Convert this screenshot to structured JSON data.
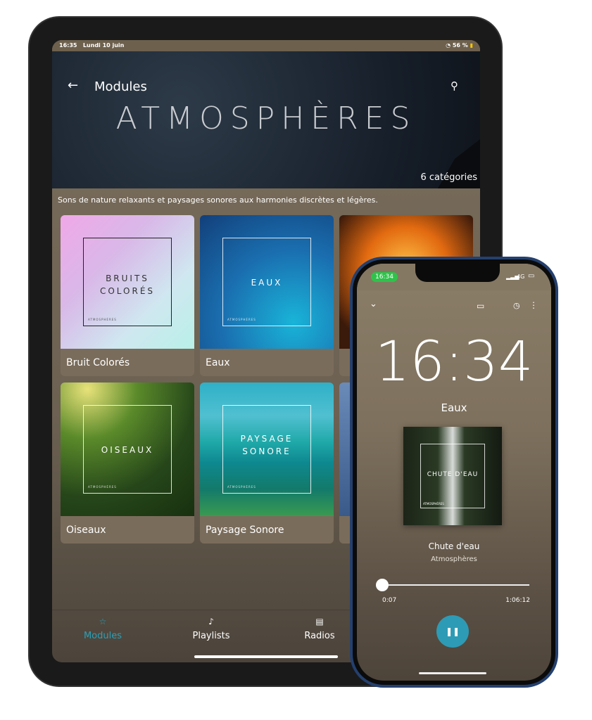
{
  "ipad": {
    "status": {
      "time": "16:35",
      "date": "Lundi 10 juin",
      "battery": "56 %"
    },
    "header": {
      "back_icon": "arrow-left-icon",
      "title": "Modules",
      "search_icon": "search-icon",
      "hero_title": "ATMOSPHÈRES",
      "count": "6 catégories"
    },
    "description": "Sons de nature relaxants et paysages sonores aux harmonies discrètes et légères.",
    "tiles": [
      {
        "label": "Bruit Colorés",
        "art_title": "BRUITS COLORÉS",
        "art_sub": "ATMOSPHÈRES"
      },
      {
        "label": "Eaux",
        "art_title": "EAUX",
        "art_sub": "ATMOSPHÈRES"
      },
      {
        "label": "",
        "art_title": "",
        "art_sub": ""
      },
      {
        "label": "Oiseaux",
        "art_title": "OISEAUX",
        "art_sub": "ATMOSPHÈRES"
      },
      {
        "label": "Paysage Sonore",
        "art_title": "PAYSAGE SONORE",
        "art_sub": "ATMOSPHÈRES"
      },
      {
        "label": "",
        "art_title": "",
        "art_sub": ""
      }
    ],
    "nav": [
      {
        "label": "Modules",
        "icon": "star-icon",
        "active": true
      },
      {
        "label": "Playlists",
        "icon": "music-note-icon",
        "active": false
      },
      {
        "label": "Radios",
        "icon": "radio-icon",
        "active": false
      }
    ],
    "accent": "#2aa0b8"
  },
  "phone": {
    "status": {
      "time": "16:34",
      "network": "4G"
    },
    "clock": "16:34",
    "module": "Eaux",
    "art_title": "CHUTE D'EAU",
    "art_sub": "ATMOSPHÈRES",
    "track": "Chute d'eau",
    "artist": "Atmosphères",
    "elapsed": "0:07",
    "duration": "1:06:12",
    "progress_percent": 0.18,
    "accent": "#2d9bb5"
  }
}
